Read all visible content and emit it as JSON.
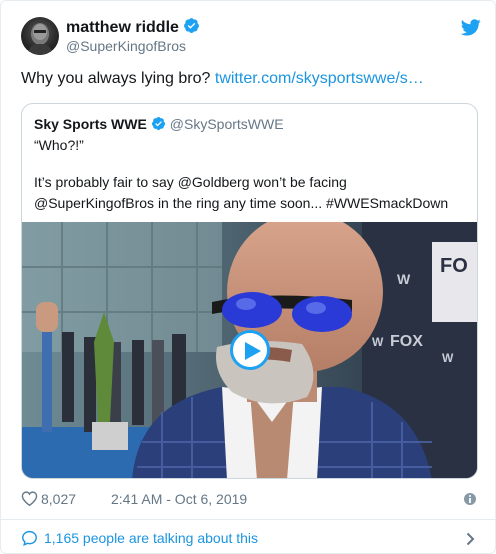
{
  "colors": {
    "accent": "#1da1f2",
    "link": "#1b95e0",
    "text": "#14171a",
    "muted": "#657786",
    "border": "#ccd6dd"
  },
  "author": {
    "display_name": "matthew riddle",
    "username": "@SuperKingofBros",
    "verified_icon": "verified-badge-icon",
    "avatar_icon": "avatar"
  },
  "brand_icon": "twitter-bird-icon",
  "tweet": {
    "text": "Why you always lying bro?",
    "link": "twitter.com/skysportswwe/s…"
  },
  "quoted": {
    "display_name": "Sky Sports WWE",
    "username": "@SkySportsWWE",
    "line1": "“Who?!”",
    "line2": "It’s probably fair to say @Goldberg won’t be facing",
    "line3": "@SuperKingofBros in the ring any time soon... #WWESmackDown",
    "media_icon": "play-icon"
  },
  "meta": {
    "likes": "8,027",
    "timestamp": "2:41 AM - Oct 6, 2019",
    "like_icon": "heart-icon",
    "info_icon": "info-icon"
  },
  "footer": {
    "text": "1,165 people are talking about this",
    "comment_icon": "speech-bubble-icon",
    "chevron_icon": "chevron-right-icon"
  }
}
